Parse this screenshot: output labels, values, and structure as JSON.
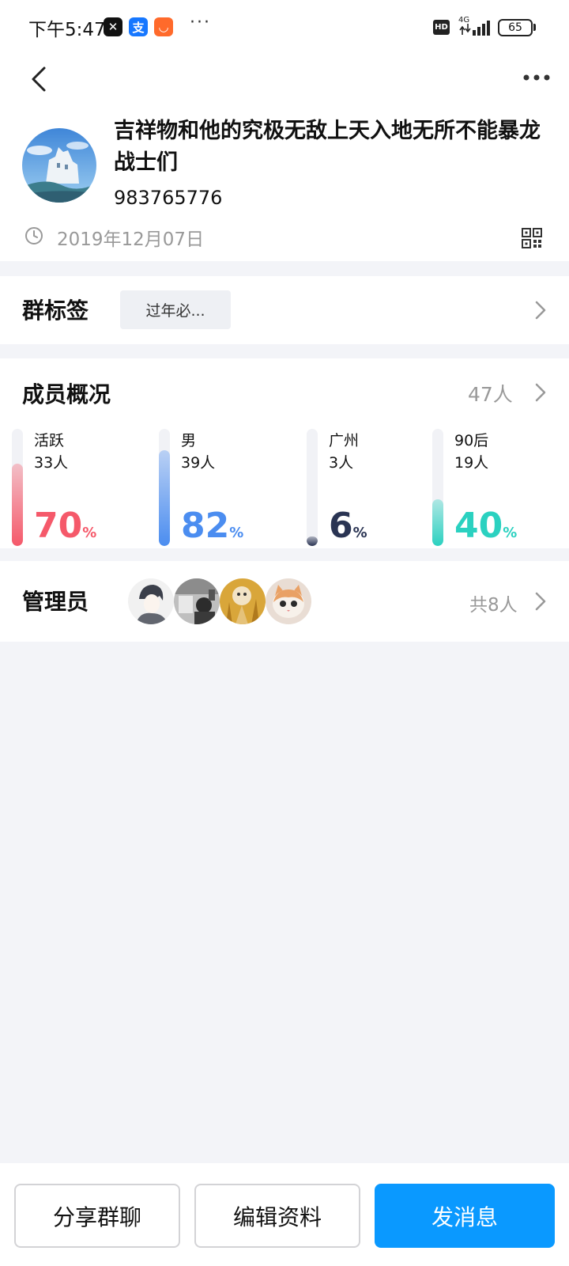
{
  "status_bar": {
    "time": "下午5:47",
    "apps": [
      "capcut-icon",
      "alipay-icon",
      "taobao-icon"
    ],
    "more": "···",
    "hd": "HD",
    "network": "4G",
    "battery": "65"
  },
  "group": {
    "name": "吉祥物和他的究极无敌上天入地无所不能暴龙战士们",
    "id": "983765776",
    "created": "2019年12月07日"
  },
  "tags": {
    "title": "群标签",
    "chip": "过年必..."
  },
  "members": {
    "title": "成员概况",
    "count": "47人",
    "stats": [
      {
        "label": "活跃",
        "count": "33人",
        "value": "70",
        "unit": "%",
        "fraction": 0.7,
        "color": "#f5596a"
      },
      {
        "label": "男",
        "count": "39人",
        "value": "82",
        "unit": "%",
        "fraction": 0.82,
        "color": "#4b8df0"
      },
      {
        "label": "广州",
        "count": "3人",
        "value": "6",
        "unit": "%",
        "fraction": 0.06,
        "color": "#2a3453"
      },
      {
        "label": "90后",
        "count": "19人",
        "value": "40",
        "unit": "%",
        "fraction": 0.4,
        "color": "#2bd1c0"
      }
    ]
  },
  "admins": {
    "title": "管理员",
    "count": "共8人"
  },
  "actions": {
    "share": "分享群聊",
    "edit": "编辑资料",
    "send": "发消息"
  },
  "colors": {
    "primary": "#0a99ff",
    "muted": "#999999"
  }
}
